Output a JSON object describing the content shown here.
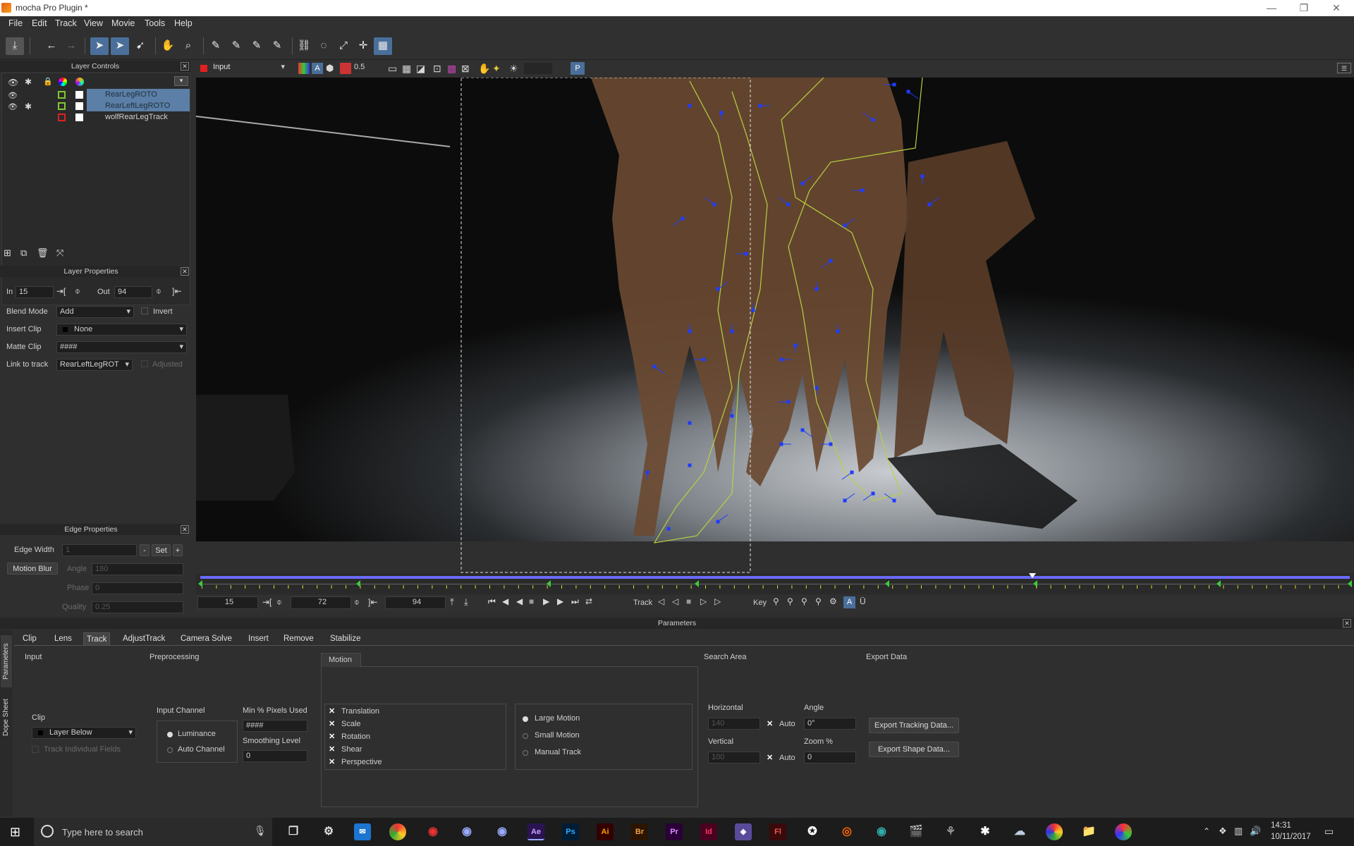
{
  "window": {
    "title": "mocha Pro Plugin *"
  },
  "menu": [
    "File",
    "Edit",
    "Track",
    "View",
    "Movie",
    "Tools",
    "Help"
  ],
  "layer_controls": {
    "title": "Layer Controls",
    "layers": [
      {
        "name": "RearLegROTO",
        "selected": true,
        "color": "#7fc832"
      },
      {
        "name": "RearLeftLegROTO",
        "selected": true,
        "color": "#7fc832"
      },
      {
        "name": "wolfRearLegTrack",
        "selected": false,
        "color": "#e02020"
      }
    ]
  },
  "layer_properties": {
    "title": "Layer Properties",
    "in_label": "In",
    "in_value": "15",
    "out_label": "Out",
    "out_value": "94",
    "blend_mode_label": "Blend Mode",
    "blend_mode": "Add",
    "invert_label": "Invert",
    "insert_clip_label": "Insert Clip",
    "insert_clip": "None",
    "matte_clip_label": "Matte Clip",
    "matte_clip": "####",
    "link_label": "Link to track",
    "link_value": "RearLeftLegROT",
    "adjusted_label": "Adjusted"
  },
  "edge_properties": {
    "title": "Edge Properties",
    "edge_width_label": "Edge Width",
    "edge_width": "1",
    "minus": "-",
    "set": "Set",
    "plus": "+",
    "motion_blur": "Motion Blur",
    "angle_label": "Angle",
    "angle": "180",
    "phase_label": "Phase",
    "phase": "0",
    "quality_label": "Quality",
    "quality": "0.25"
  },
  "viewer": {
    "clip": "Input",
    "zoom": "0.5",
    "proxy": "P"
  },
  "timeline": {
    "in": "15",
    "current": "72",
    "out": "94",
    "track_label": "Track",
    "key_label": "Key",
    "playhead_fraction": 0.72
  },
  "parameters": {
    "title": "Parameters",
    "side_tabs": [
      "Parameters",
      "Dope Sheet"
    ],
    "tabs": [
      "Clip",
      "Lens",
      "Track",
      "AdjustTrack",
      "Camera Solve",
      "Insert",
      "Remove",
      "Stabilize"
    ],
    "active_tab": "Track",
    "input": {
      "title": "Input",
      "clip_label": "Clip",
      "clip": "Layer Below",
      "track_fields": "Track Individual Fields"
    },
    "preprocessing": {
      "title": "Preprocessing",
      "channel_label": "Input Channel",
      "luminance": "Luminance",
      "auto_channel": "Auto Channel",
      "min_pixels_label": "Min % Pixels Used",
      "min_pixels": "####",
      "smoothing_label": "Smoothing Level",
      "smoothing": "0"
    },
    "motion": {
      "title": "Motion",
      "types": [
        "Translation",
        "Scale",
        "Rotation",
        "Shear",
        "Perspective"
      ],
      "modes": [
        "Large Motion",
        "Small Motion",
        "Manual Track"
      ],
      "selected_mode": "Large Motion"
    },
    "search_area": {
      "title": "Search Area",
      "horizontal_label": "Horizontal",
      "horizontal": "140",
      "vertical_label": "Vertical",
      "vertical": "100",
      "auto": "Auto",
      "angle_label": "Angle",
      "angle": "0°",
      "zoom_label": "Zoom %",
      "zoom": "0"
    },
    "export": {
      "title": "Export Data",
      "tracking": "Export Tracking Data...",
      "shape": "Export Shape Data..."
    }
  },
  "taskbar": {
    "search_placeholder": "Type here to search",
    "time": "14:31",
    "date": "10/11/2017",
    "apps": [
      "Ae",
      "Ps",
      "Ai",
      "Br",
      "Pr",
      "Id",
      "Fl"
    ]
  }
}
